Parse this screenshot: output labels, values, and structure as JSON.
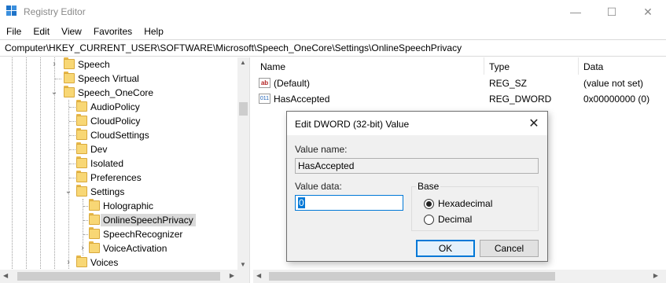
{
  "window": {
    "title": "Registry Editor",
    "icon": "registry-editor-icon",
    "minimize_glyph": "—",
    "maximize_glyph": "☐",
    "close_glyph": "✕"
  },
  "menu": {
    "items": [
      "File",
      "Edit",
      "View",
      "Favorites",
      "Help"
    ]
  },
  "address": {
    "path": "Computer\\HKEY_CURRENT_USER\\SOFTWARE\\Microsoft\\Speech_OneCore\\Settings\\OnlineSpeechPrivacy"
  },
  "tree": {
    "items": [
      {
        "label": "Speech",
        "expander": "›",
        "selected": false
      },
      {
        "label": "Speech Virtual",
        "expander": "",
        "selected": false
      },
      {
        "label": "Speech_OneCore",
        "expander": "⌄",
        "selected": false
      },
      {
        "label": "AudioPolicy",
        "expander": "",
        "selected": false
      },
      {
        "label": "CloudPolicy",
        "expander": "",
        "selected": false
      },
      {
        "label": "CloudSettings",
        "expander": "",
        "selected": false
      },
      {
        "label": "Dev",
        "expander": "",
        "selected": false
      },
      {
        "label": "Isolated",
        "expander": "",
        "selected": false
      },
      {
        "label": "Preferences",
        "expander": "",
        "selected": false
      },
      {
        "label": "Settings",
        "expander": "⌄",
        "selected": false
      },
      {
        "label": "Holographic",
        "expander": "",
        "selected": false
      },
      {
        "label": "OnlineSpeechPrivacy",
        "expander": "",
        "selected": true
      },
      {
        "label": "SpeechRecognizer",
        "expander": "",
        "selected": false
      },
      {
        "label": "VoiceActivation",
        "expander": "›",
        "selected": false
      },
      {
        "label": "Voices",
        "expander": "›",
        "selected": false
      }
    ]
  },
  "list": {
    "columns": {
      "name": "Name",
      "type": "Type",
      "data": "Data"
    },
    "rows": [
      {
        "icon": "ab",
        "name": "(Default)",
        "type": "REG_SZ",
        "data": "(value not set)"
      },
      {
        "icon": "011",
        "name": "HasAccepted",
        "type": "REG_DWORD",
        "data": "0x00000000 (0)"
      }
    ]
  },
  "dialog": {
    "title": "Edit DWORD (32-bit) Value",
    "close_glyph": "✕",
    "value_name_label": "Value name:",
    "value_name": "HasAccepted",
    "value_data_label": "Value data:",
    "value_data": "0",
    "base_label": "Base",
    "base_options": [
      {
        "label": "Hexadecimal",
        "checked": true
      },
      {
        "label": "Decimal",
        "checked": false
      }
    ],
    "ok_label": "OK",
    "cancel_label": "Cancel"
  }
}
